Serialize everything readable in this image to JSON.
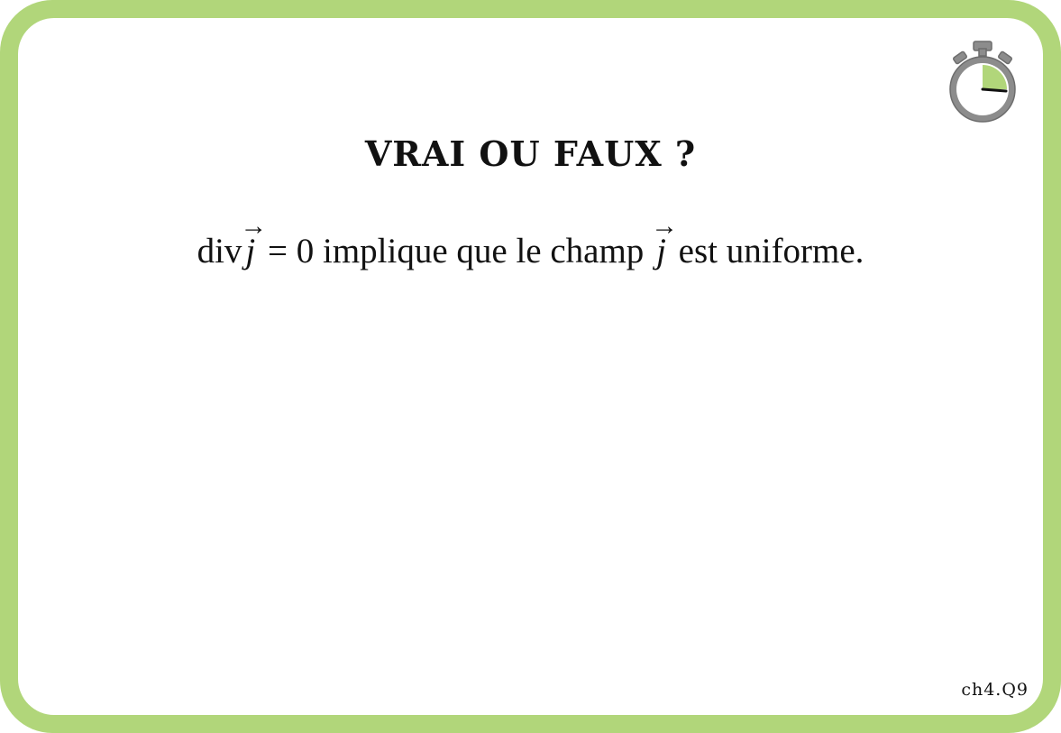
{
  "card": {
    "title": "VRAI OU FAUX ?",
    "statement": {
      "prefix": "div",
      "vector_symbol": "j",
      "arrow": "→",
      "middle": " = 0 implique que le champ ",
      "suffix": " est uniforme."
    },
    "code": "ch4.Q9"
  },
  "timer": {
    "icon": "stopwatch-icon",
    "elapsed_fraction": 0.25
  },
  "colors": {
    "frame": "#b1d67a",
    "timer_gray": "#8c8c8c",
    "timer_fill": "#b1d67a",
    "text": "#111111"
  }
}
